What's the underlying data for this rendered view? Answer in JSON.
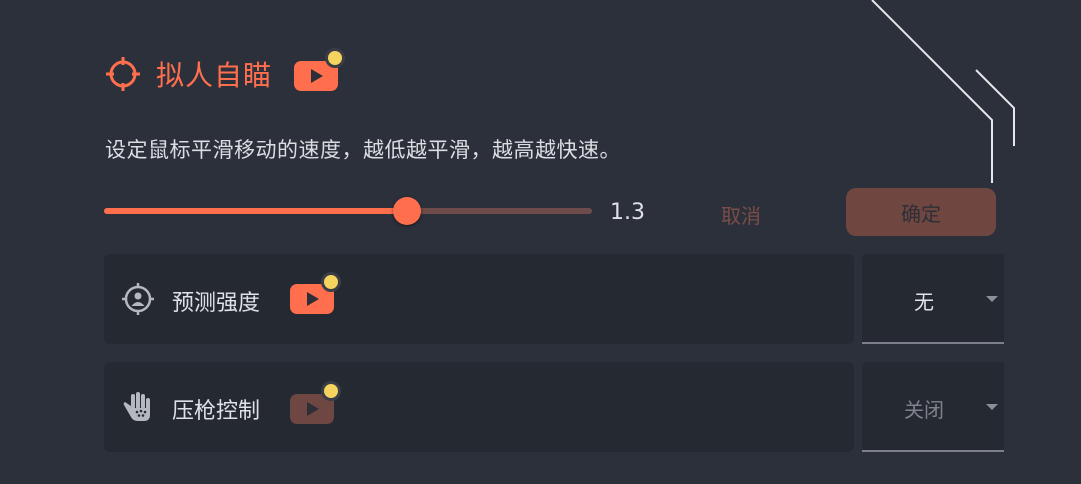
{
  "feature": {
    "title": "拟人自瞄",
    "description": "设定鼠标平滑移动的速度，越低越平滑，越高越快速。",
    "title_icon": "crosshair-icon",
    "video_icon": "youtube-icon"
  },
  "slider": {
    "value_text": "1.3",
    "fill_fraction": 0.62
  },
  "buttons": {
    "cancel_label": "取消",
    "confirm_label": "确定"
  },
  "settings": [
    {
      "icon": "target-person-icon",
      "label": "预测强度",
      "value": "无",
      "enabled": true
    },
    {
      "icon": "hand-icon",
      "label": "压枪控制",
      "value": "关闭",
      "enabled": false
    }
  ],
  "colors": {
    "accent": "#ff6f4e",
    "accent_dim": "#704641",
    "background": "#2c303b",
    "panel": "#252932",
    "badge_dot": "#f4d35e"
  }
}
